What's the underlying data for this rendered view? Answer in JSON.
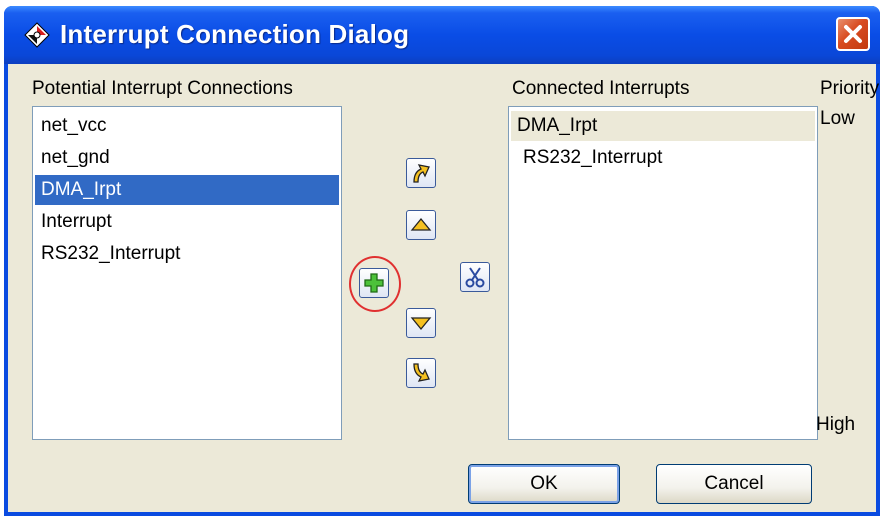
{
  "window": {
    "title": "Interrupt Connection Dialog"
  },
  "potential": {
    "label": "Potential Interrupt Connections",
    "items": [
      "net_vcc",
      "net_gnd",
      "DMA_Irpt",
      "Interrupt",
      "RS232_Interrupt"
    ],
    "selected": "DMA_Irpt"
  },
  "connected": {
    "label": "Connected Interrupts",
    "items": [
      "DMA_Irpt",
      "RS232_Interrupt"
    ]
  },
  "priority": {
    "label": "Priority",
    "low": "Low",
    "high": "High"
  },
  "buttons": {
    "ok": "OK",
    "cancel": "Cancel"
  },
  "icons": {
    "app": "diamond-logo-icon",
    "close": "close-icon",
    "move_top": "move-to-top-icon",
    "move_up": "move-up-icon",
    "add": "add-icon",
    "remove": "scissors-icon",
    "move_down": "move-down-icon",
    "move_bottom": "move-to-bottom-icon"
  },
  "colors": {
    "titlebar": "#0a4be0",
    "selection": "#316ac5",
    "dialog_bg": "#ece9d8",
    "highlight_ring": "#e03030"
  }
}
